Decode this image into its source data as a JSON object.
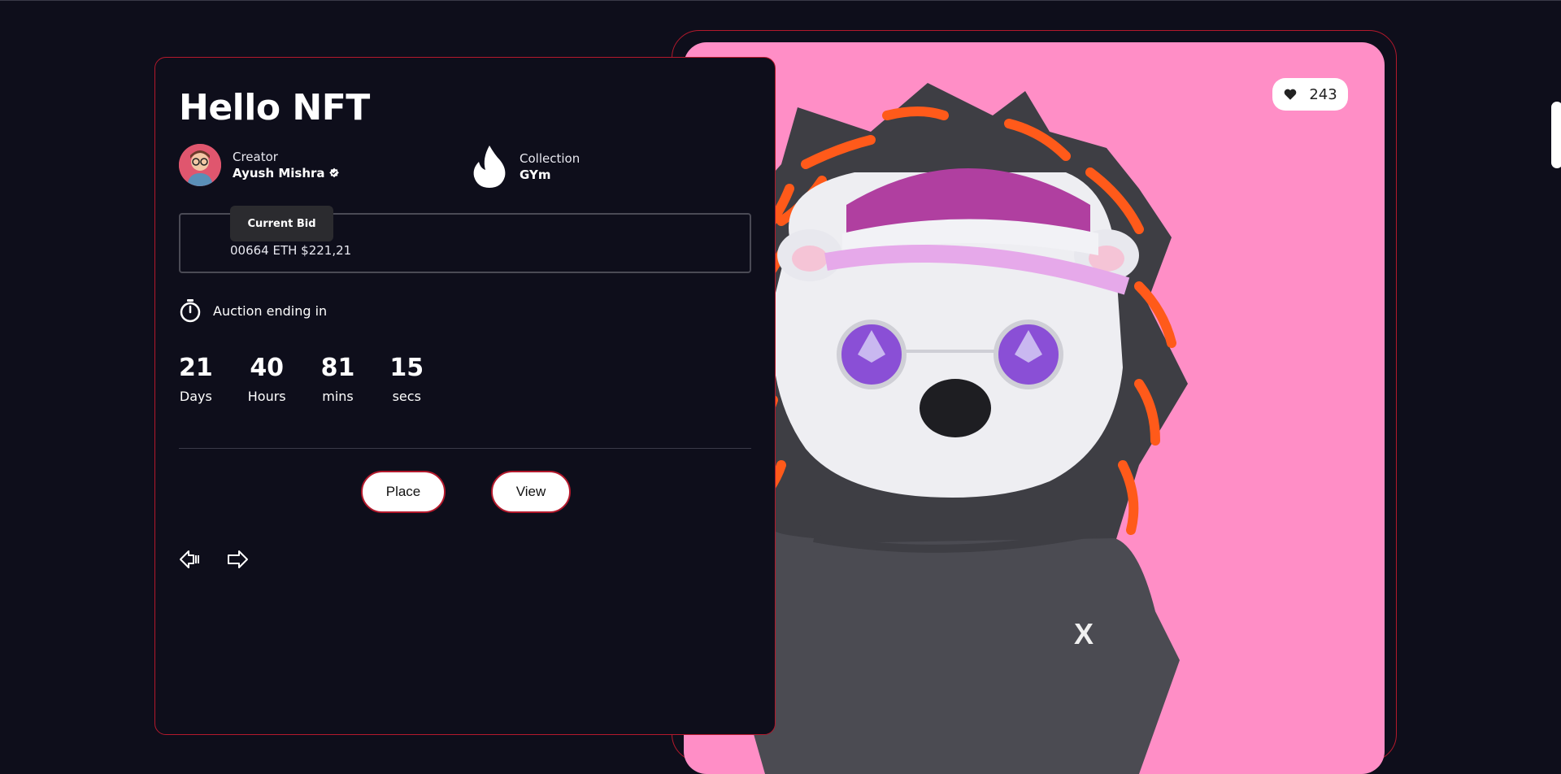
{
  "nft": {
    "title": "Hello NFT",
    "likes": "243"
  },
  "creator": {
    "label": "Creator",
    "name": "Ayush Mishra"
  },
  "collection": {
    "label": "Collection",
    "name": "GYm"
  },
  "bid": {
    "label": "Current Bid",
    "value": "00664 ETH $221,21"
  },
  "auction": {
    "label": "Auction ending in",
    "countdown": [
      {
        "value": "21",
        "unit": "Days"
      },
      {
        "value": "40",
        "unit": "Hours"
      },
      {
        "value": "81",
        "unit": "mins"
      },
      {
        "value": "15",
        "unit": "secs"
      }
    ]
  },
  "actions": {
    "place_label": "Place",
    "view_label": "View"
  },
  "icons": {
    "heart": "heart-icon",
    "verified": "verified-badge-icon",
    "fire": "fire-icon",
    "timer": "stopwatch-icon",
    "prev": "arrow-left-icon",
    "next": "arrow-right-icon"
  },
  "colors": {
    "background": "#0e0e1b",
    "accent_border": "#b3192c",
    "art_background": "#ff8ec6",
    "bid_tag": "#2b2b2f"
  }
}
